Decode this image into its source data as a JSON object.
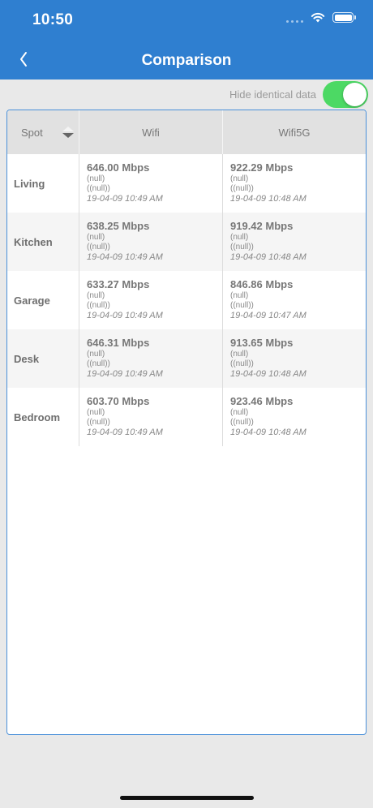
{
  "status_bar": {
    "time": "10:50"
  },
  "nav": {
    "back_icon": "chevron-left-icon",
    "title": "Comparison"
  },
  "toggle": {
    "label": "Hide identical data",
    "state": "on",
    "color": "#4cd964"
  },
  "table": {
    "columns": [
      "Spot",
      "Wifi",
      "Wifi5G"
    ],
    "rows": [
      {
        "spot": "Living",
        "wifi": {
          "speed": "646.00 Mbps",
          "line1": "(null)",
          "line2": "((null))",
          "date": "19-04-09 10:49 AM"
        },
        "wifi5g": {
          "speed": "922.29 Mbps",
          "line1": "(null)",
          "line2": "((null))",
          "date": "19-04-09 10:48 AM"
        }
      },
      {
        "spot": "Kitchen",
        "wifi": {
          "speed": "638.25 Mbps",
          "line1": "(null)",
          "line2": "((null))",
          "date": "19-04-09 10:49 AM"
        },
        "wifi5g": {
          "speed": "919.42 Mbps",
          "line1": "(null)",
          "line2": "((null))",
          "date": "19-04-09 10:48 AM"
        }
      },
      {
        "spot": "Garage",
        "wifi": {
          "speed": "633.27 Mbps",
          "line1": "(null)",
          "line2": "((null))",
          "date": "19-04-09 10:49 AM"
        },
        "wifi5g": {
          "speed": "846.86 Mbps",
          "line1": "(null)",
          "line2": "((null))",
          "date": "19-04-09 10:47 AM"
        }
      },
      {
        "spot": "Desk",
        "wifi": {
          "speed": "646.31 Mbps",
          "line1": "(null)",
          "line2": "((null))",
          "date": "19-04-09 10:49 AM"
        },
        "wifi5g": {
          "speed": "913.65 Mbps",
          "line1": "(null)",
          "line2": "((null))",
          "date": "19-04-09 10:48 AM"
        }
      },
      {
        "spot": "Bedroom",
        "wifi": {
          "speed": "603.70 Mbps",
          "line1": "(null)",
          "line2": "((null))",
          "date": "19-04-09 10:49 AM"
        },
        "wifi5g": {
          "speed": "923.46 Mbps",
          "line1": "(null)",
          "line2": "((null))",
          "date": "19-04-09 10:48 AM"
        }
      }
    ]
  },
  "colors": {
    "header": "#2f7fd0",
    "panel_border": "#4a90d9",
    "background": "#e9e9e9"
  }
}
